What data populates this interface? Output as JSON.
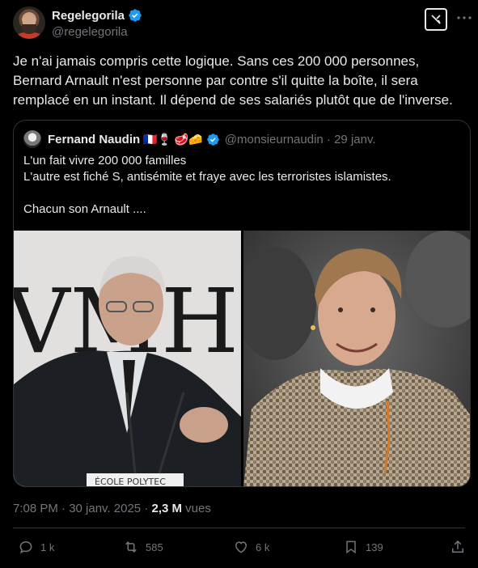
{
  "author": {
    "display_name": "Regelegorila",
    "handle": "@regelegorila"
  },
  "tweet": {
    "text": "Je n'ai jamais compris cette logique. Sans ces 200 000 personnes, Bernard Arnault n'est personne par contre s'il quitte la boîte, il sera remplacé en un instant. Il dépend de ses salariés plutôt que de l'inverse."
  },
  "quote": {
    "display_name": "Fernand Naudin",
    "emojis": "🇫🇷🍷 🥩🧀",
    "handle_date": "@monsieurnaudin · 29 janv.",
    "lines": [
      "L'un fait vivre 200 000 familles",
      "L'autre est fiché S, antisémite et fraye avec les terroristes islamistes.",
      "",
      "Chacun son Arnault ...."
    ],
    "left_image_watermark": "ÉCOLE POLYTEC"
  },
  "meta": {
    "timestamp": "7:08 PM · 30 janv. 2025 · ",
    "views_count": "2,3 M",
    "views_label": " vues"
  },
  "actions": {
    "replies": "1 k",
    "reposts": "585",
    "likes": "6 k",
    "bookmarks": "139"
  },
  "colors": {
    "background": "#000000",
    "text": "#e7e9ea",
    "secondary": "#71767b",
    "verified": "#1d9bf0",
    "border": "#2f3336"
  },
  "icons": [
    "verified-badge-icon",
    "grok-icon",
    "more-icon",
    "reply-icon",
    "repost-icon",
    "like-icon",
    "bookmark-icon",
    "share-icon"
  ]
}
